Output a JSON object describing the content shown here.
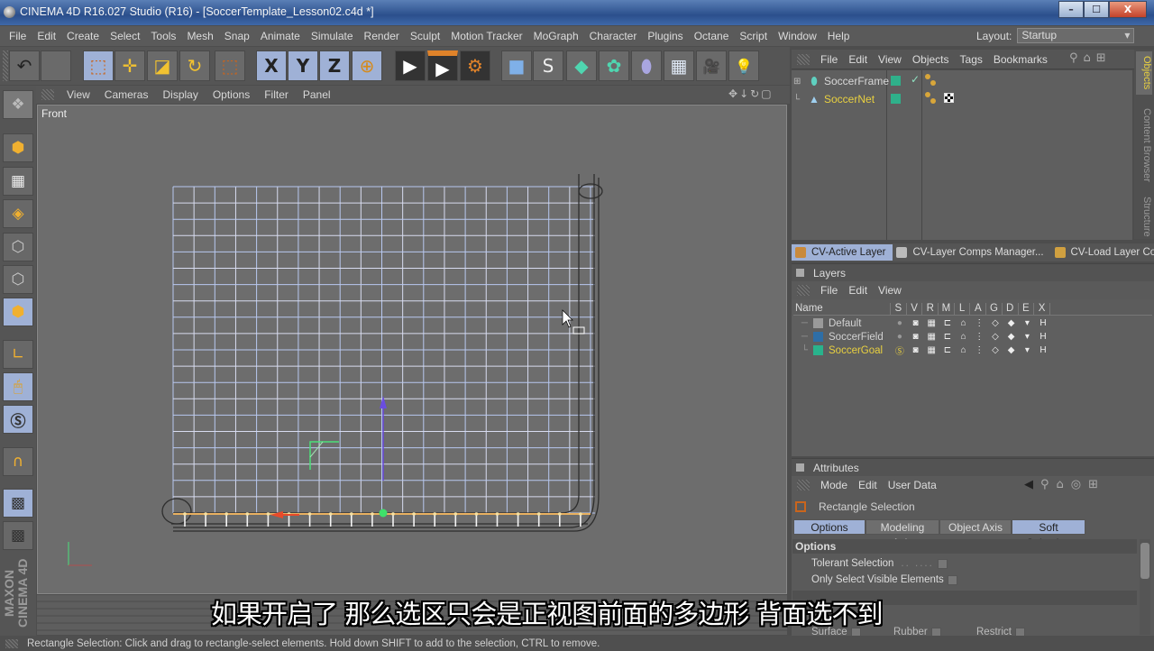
{
  "window": {
    "title": "CINEMA 4D R16.027 Studio (R16) - [SoccerTemplate_Lesson02.c4d *]",
    "controls": {
      "minimize": "–",
      "maximize": "☐",
      "close": "X"
    }
  },
  "menubar": {
    "items": [
      "File",
      "Edit",
      "Create",
      "Select",
      "Tools",
      "Mesh",
      "Snap",
      "Animate",
      "Simulate",
      "Render",
      "Sculpt",
      "Motion Tracker",
      "MoGraph",
      "Character",
      "Plugins",
      "Octane",
      "Script",
      "Window",
      "Help"
    ],
    "layout_label": "Layout:",
    "layout_value": "Startup"
  },
  "toolbar": {
    "tools": [
      {
        "name": "undo",
        "glyph": "↶"
      },
      {
        "name": "redo",
        "glyph": ""
      },
      {
        "name": "rectangle-selection",
        "glyph": "⬚"
      },
      {
        "name": "move",
        "glyph": "✛"
      },
      {
        "name": "scale",
        "glyph": "◪"
      },
      {
        "name": "rotate",
        "glyph": "↻"
      },
      {
        "name": "live-selection",
        "glyph": "⬚"
      },
      {
        "name": "x-axis",
        "glyph": "X"
      },
      {
        "name": "y-axis",
        "glyph": "Y"
      },
      {
        "name": "z-axis",
        "glyph": "Z"
      },
      {
        "name": "coordinate-system",
        "glyph": "⊕"
      },
      {
        "name": "render-view",
        "glyph": "▶"
      },
      {
        "name": "render-to-picture-viewer",
        "glyph": "▶"
      },
      {
        "name": "render-settings",
        "glyph": "⚙"
      },
      {
        "name": "cube",
        "glyph": "■"
      },
      {
        "name": "spline-pen",
        "glyph": "S"
      },
      {
        "name": "subdivision-surface",
        "glyph": "◆"
      },
      {
        "name": "cloner",
        "glyph": "✿"
      },
      {
        "name": "deformer",
        "glyph": "⬮"
      },
      {
        "name": "floor",
        "glyph": "▦"
      },
      {
        "name": "camera",
        "glyph": "🎥"
      },
      {
        "name": "light",
        "glyph": "💡"
      }
    ]
  },
  "left_toolbar": {
    "tools": [
      "make-editable",
      "model-mode",
      "texture-mode",
      "workplane-mode",
      "points-mode",
      "edges-mode",
      "polygons-mode",
      "axis-mode",
      "tweak-mode",
      "solo-mode",
      "snap",
      "workplane-lock",
      "workplane-align"
    ],
    "brand": "MAXON CINEMA 4D"
  },
  "viewport": {
    "menu": [
      "View",
      "Cameras",
      "Display",
      "Options",
      "Filter",
      "Panel"
    ],
    "view_name": "Front"
  },
  "objects_panel": {
    "menu": [
      "File",
      "Edit",
      "View",
      "Objects",
      "Tags",
      "Bookmarks"
    ],
    "objects": [
      {
        "name": "SoccerFrame",
        "selected": false,
        "expanded": true
      },
      {
        "name": "SoccerNet",
        "selected": true,
        "expanded": false
      }
    ],
    "side_tabs": [
      "Objects",
      "Content Browser",
      "Structure"
    ]
  },
  "cv_tabs": [
    "CV-Active Layer",
    "CV-Layer Comps Manager...",
    "CV-Load Layer Co"
  ],
  "layers_panel": {
    "title": "Layers",
    "menu": [
      "File",
      "Edit",
      "View"
    ],
    "columns": [
      "Name",
      "S",
      "V",
      "R",
      "M",
      "L",
      "A",
      "G",
      "D",
      "E",
      "X"
    ],
    "layers": [
      {
        "name": "Default",
        "color": "#9a9a9a",
        "active": false
      },
      {
        "name": "SoccerField",
        "color": "#2e6ea6",
        "active": false
      },
      {
        "name": "SoccerGoal",
        "color": "#29b38c",
        "active": true
      }
    ]
  },
  "attributes_panel": {
    "title": "Attributes",
    "menu": [
      "Mode",
      "Edit",
      "User Data"
    ],
    "tool_name": "Rectangle Selection",
    "tabs": [
      {
        "label": "Options",
        "active": true
      },
      {
        "label": "Modeling Axis",
        "active": false
      },
      {
        "label": "Object Axis",
        "active": false
      },
      {
        "label": "Soft Selection",
        "active": true
      }
    ],
    "section": "Options",
    "options": [
      {
        "label": "Tolerant Selection",
        "checked": false
      },
      {
        "label": "Only Select Visible Elements",
        "checked": false
      }
    ],
    "soft_section_fields": [
      {
        "label": "Surface",
        "checked": false
      },
      {
        "label": "Rubber",
        "checked": false
      },
      {
        "label": "Restrict",
        "checked": false
      }
    ]
  },
  "status_bar": {
    "text": "Rectangle Selection: Click and drag to rectangle-select elements. Hold down SHIFT to add to the selection, CTRL to remove."
  },
  "subtitle": "如果开启了 那么选区只会是正视图前面的多边形 背面选不到",
  "colors": {
    "accent_blue": "#9fb1d6",
    "highlight_yellow": "#e8d040",
    "ui_bg": "#555555",
    "viewport_bg": "#6d6d6d"
  }
}
